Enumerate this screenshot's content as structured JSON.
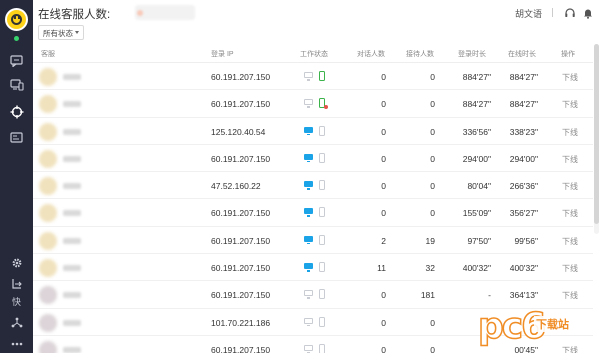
{
  "header": {
    "title": "在线客服人数:",
    "user_name": "胡文语"
  },
  "filter": {
    "selected": "所有状态"
  },
  "table": {
    "columns": {
      "agent": "客服",
      "ip": "登录 IP",
      "status": "工作状态",
      "dialog": "对话人数",
      "received": "接待人数",
      "login": "登录时长",
      "online": "在线时长",
      "action": "操作"
    },
    "rows": [
      {
        "ip": "60.191.207.150",
        "pc": false,
        "mobile": true,
        "mobile_badge": false,
        "dialog": "0",
        "received": "0",
        "login": "884'27\"",
        "online": "884'27\"",
        "action": "下线"
      },
      {
        "ip": "60.191.207.150",
        "pc": false,
        "mobile": true,
        "mobile_badge": true,
        "dialog": "0",
        "received": "0",
        "login": "884'27\"",
        "online": "884'27\"",
        "action": "下线"
      },
      {
        "ip": "125.120.40.54",
        "pc": true,
        "mobile": false,
        "mobile_badge": false,
        "dialog": "0",
        "received": "0",
        "login": "336'56\"",
        "online": "338'23\"",
        "action": "下线"
      },
      {
        "ip": "60.191.207.150",
        "pc": true,
        "mobile": false,
        "mobile_badge": false,
        "dialog": "0",
        "received": "0",
        "login": "294'00\"",
        "online": "294'00\"",
        "action": "下线"
      },
      {
        "ip": "47.52.160.22",
        "pc": true,
        "mobile": false,
        "mobile_badge": false,
        "dialog": "0",
        "received": "0",
        "login": "80'04\"",
        "online": "266'36\"",
        "action": "下线"
      },
      {
        "ip": "60.191.207.150",
        "pc": true,
        "mobile": false,
        "mobile_badge": false,
        "dialog": "0",
        "received": "0",
        "login": "155'09\"",
        "online": "356'27\"",
        "action": "下线"
      },
      {
        "ip": "60.191.207.150",
        "pc": true,
        "mobile": false,
        "mobile_badge": false,
        "dialog": "2",
        "received": "19",
        "login": "97'50\"",
        "online": "99'56\"",
        "action": "下线"
      },
      {
        "ip": "60.191.207.150",
        "pc": true,
        "mobile": false,
        "mobile_badge": false,
        "dialog": "11",
        "received": "32",
        "login": "400'32\"",
        "online": "400'32\"",
        "action": "下线"
      },
      {
        "ip": "60.191.207.150",
        "pc": false,
        "mobile": false,
        "mobile_badge": false,
        "dialog": "0",
        "received": "181",
        "login": "-",
        "online": "364'13\"",
        "action": "下线"
      },
      {
        "ip": "101.70.221.186",
        "pc": false,
        "mobile": false,
        "mobile_badge": false,
        "dialog": "0",
        "received": "0",
        "login": "",
        "online": "",
        "action": ""
      },
      {
        "ip": "60.191.207.150",
        "pc": false,
        "mobile": false,
        "mobile_badge": false,
        "dialog": "0",
        "received": "0",
        "login": "",
        "online": "00'45\"",
        "action": "下线"
      }
    ]
  },
  "watermark": {
    "big": "pc6",
    "small": "下载站"
  },
  "colors": {
    "rail": "#26293a",
    "pc_on": "#1aa3e6",
    "mobile_on": "#3cb34a",
    "online_dot": "#37d36c"
  }
}
